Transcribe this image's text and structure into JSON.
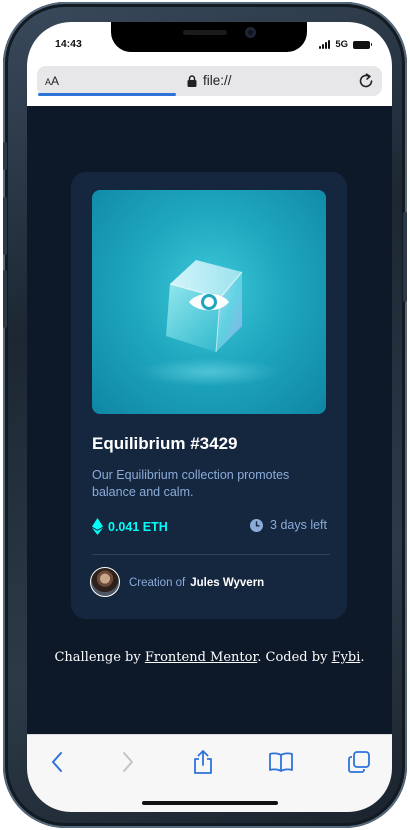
{
  "status_bar": {
    "time": "14:43",
    "network": "5G"
  },
  "browser": {
    "text_size_small": "A",
    "text_size_large": "A",
    "url": "file://",
    "load_progress": 0.4
  },
  "card": {
    "title": "Equilibrium #3429",
    "description": "Our Equilibrium collection promotes balance and calm.",
    "price": "0.041 ETH",
    "time_left": "3 days left",
    "creator_label": "Creation of",
    "creator_name": "Jules Wyvern",
    "image_icon": "eye-icon",
    "price_icon": "ethereum-icon",
    "time_icon": "clock-icon"
  },
  "attribution": {
    "prefix": "Challenge by ",
    "link1": "Frontend Mentor",
    "middle": ". Coded by ",
    "link2": "Fybi",
    "suffix": "."
  },
  "toolbar": {
    "icons": [
      "back-icon",
      "forward-icon",
      "share-icon",
      "bookmarks-icon",
      "tabs-icon"
    ]
  },
  "colors": {
    "page_bg": "#0d1829",
    "card_bg": "#15263f",
    "cyan": "#00fff8",
    "soft_blue": "#8bacd9",
    "accent_blue": "#2d73d9"
  }
}
